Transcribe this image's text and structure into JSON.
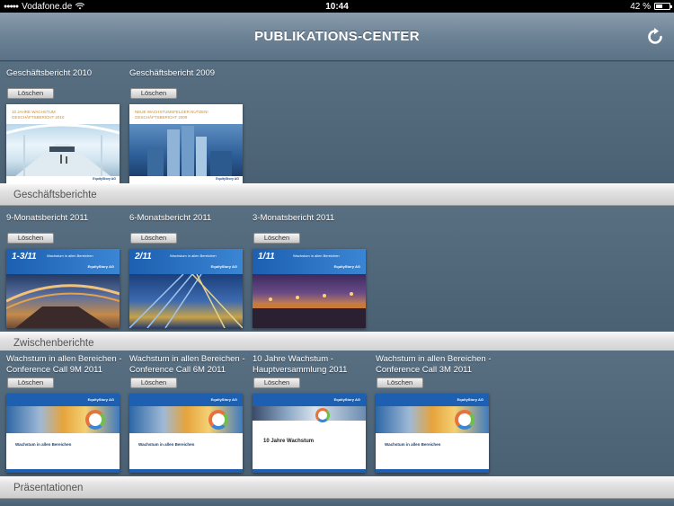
{
  "status": {
    "carrier": "Vodafone.de",
    "time": "10:44",
    "battery_text": "42 %",
    "battery_level": 0.42
  },
  "nav": {
    "title": "PUBLIKATIONS-CENTER",
    "refresh_icon": "refresh-icon"
  },
  "delete_label": "Löschen",
  "shelves": [
    {
      "label": "Geschäftsberichte",
      "items": [
        {
          "title": "Geschäftsbericht 2010",
          "cover_head": "10 JAHRE WACHSTUM\nGESCHÄFTSBERICHT 2010",
          "logo": "EquityStory AG"
        },
        {
          "title": "Geschäftsbericht 2009",
          "cover_head": "NEUE WACHSTUMSFELDER NUTZEN!\nGESCHÄFTSBERICHT 2009",
          "logo": "EquityStory AG"
        }
      ]
    },
    {
      "label": "Zwischenberichte",
      "items": [
        {
          "title": "9-Monatsbericht 2011",
          "cover_num": "1-3/11",
          "cover_tag": "Wachstum in allen Bereichen",
          "logo": "EquityStory AG"
        },
        {
          "title": "6-Monatsbericht 2011",
          "cover_num": "2/11",
          "cover_tag": "Wachstum in allen Bereichen",
          "logo": "EquityStory AG"
        },
        {
          "title": "3-Monatsbericht 2011",
          "cover_num": "1/11",
          "cover_tag": "Wachstum in allen Bereichen",
          "logo": "EquityStory AG"
        }
      ]
    },
    {
      "label": "Präsentationen",
      "items": [
        {
          "title": "Wachstum in allen Bereichen -\nConference Call 9M 2011",
          "cover_title": "Wachstum in allen Bereichen",
          "logo": "EquityStory AG"
        },
        {
          "title": "Wachstum in allen Bereichen -\nConference Call 6M 2011",
          "cover_title": "Wachstum in allen Bereichen",
          "logo": "EquityStory AG"
        },
        {
          "title": "10 Jahre Wachstum -\nHauptversammlung 2011",
          "cover_title": "10 Jahre Wachstum",
          "logo": "EquityStory AG"
        },
        {
          "title": "Wachstum in allen Bereichen -\nConference Call 3M 2011",
          "cover_title": "Wachstum in allen Bereichen",
          "logo": "EquityStory AG"
        }
      ]
    }
  ]
}
